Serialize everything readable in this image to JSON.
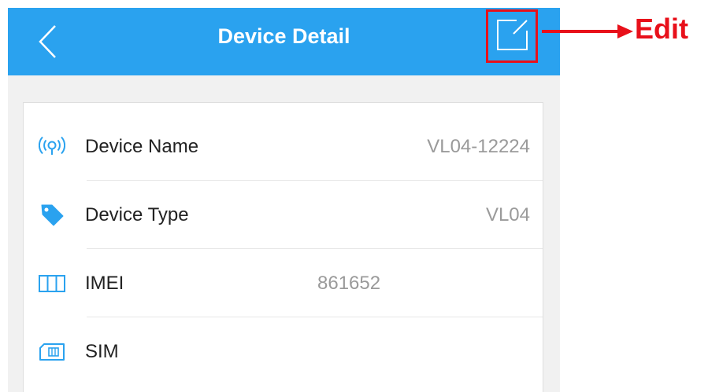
{
  "header": {
    "title": "Device Detail",
    "back_icon": "chevron-left-icon",
    "edit_icon": "edit-icon",
    "background_color": "#2aa2ef"
  },
  "details": [
    {
      "icon": "signal-icon",
      "label": "Device Name",
      "value": "VL04-12224"
    },
    {
      "icon": "tag-icon",
      "label": "Device Type",
      "value": "VL04"
    },
    {
      "icon": "barcode-icon",
      "label": "IMEI",
      "value": "861652"
    },
    {
      "icon": "sim-card-icon",
      "label": "SIM",
      "value": ""
    }
  ],
  "annotation": {
    "label": "Edit",
    "color": "#e8101a"
  }
}
